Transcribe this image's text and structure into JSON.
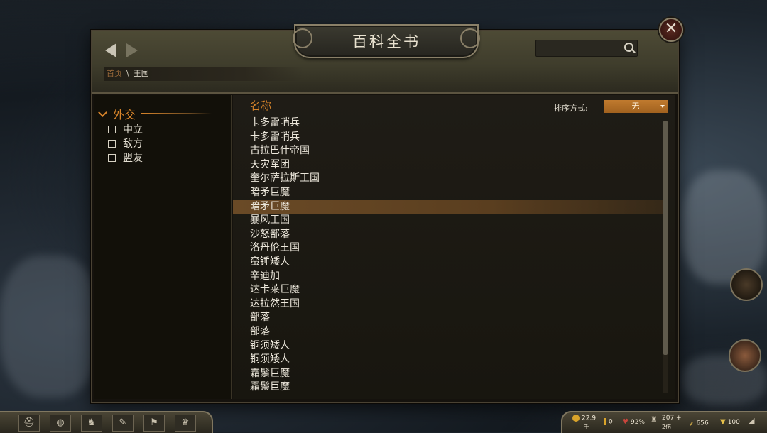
{
  "window": {
    "title": "百科全书"
  },
  "breadcrumb": {
    "home": "首页",
    "separator": "\\",
    "current": "王国"
  },
  "search": {
    "placeholder": ""
  },
  "sidebar": {
    "category": "外交",
    "filters": [
      {
        "label": "中立",
        "checked": false
      },
      {
        "label": "敌方",
        "checked": false
      },
      {
        "label": "盟友",
        "checked": false
      }
    ]
  },
  "list": {
    "column_header": "名称",
    "sort_label": "排序方式:",
    "sort_value": "无",
    "selected_index": 6,
    "entries": [
      "卡多雷哨兵",
      "卡多雷哨兵",
      "古拉巴什帝国",
      "天灾军团",
      "奎尔萨拉斯王国",
      "暗矛巨魔",
      "暗矛巨魔",
      "暴风王国",
      "沙怒部落",
      "洛丹伦王国",
      "蛮锤矮人",
      "辛迪加",
      "达卡莱巨魔",
      "达拉然王国",
      "部落",
      "部落",
      "铜须矮人",
      "铜须矮人",
      "霜鬃巨魔",
      "霜鬃巨魔"
    ]
  },
  "status_bar": {
    "gold": "22.9",
    "gold_sub": "千",
    "influence": "0",
    "health": "92%",
    "troops": "207",
    "troops_plus": "+",
    "wounded": "2伤",
    "food": "656",
    "morale": "100"
  },
  "colors": {
    "accent": "#d7842a",
    "selected_row": "#6a4a26",
    "text": "#ece7db"
  }
}
